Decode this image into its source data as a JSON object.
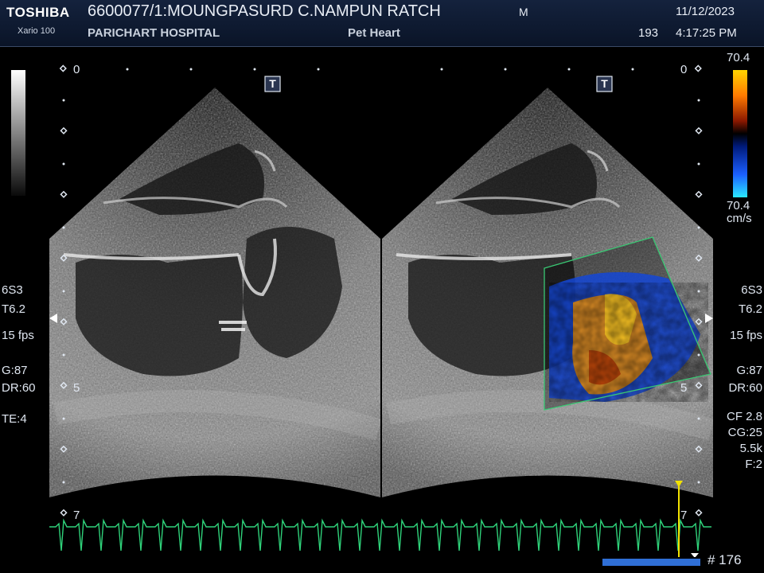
{
  "header": {
    "brand": "TOSHIBA",
    "model": "Xario 100",
    "patient": "6600077/1:MOUNGPASURD C.NAMPUN RATCH",
    "sex": "M",
    "hospital": "PARICHART HOSPITAL",
    "study": "Pet Heart",
    "date": "11/12/2023",
    "counter": "193",
    "time": "4:17:25 PM"
  },
  "scale": {
    "depth_top_left": "0",
    "depth_top_right": "0",
    "depth_mid_left": "5",
    "depth_mid_right": "5",
    "depth_bottom_left": "7",
    "depth_bottom_right": "7"
  },
  "colorbar": {
    "top": "70.4",
    "bottom": "70.4",
    "unit": "cm/s"
  },
  "left_params": [
    "6S3",
    "T6.2",
    "15 fps",
    "G:87",
    "DR:60",
    "TE:4"
  ],
  "right_params": [
    "6S3",
    "T6.2",
    "15 fps",
    "G:87",
    "DR:60",
    "CF 2.8",
    "CG:25",
    "5.5k",
    "F:2"
  ],
  "markers": {
    "left_t": "T",
    "right_t": "T"
  },
  "cine": {
    "frame": "# 176"
  },
  "colors": {
    "ecg": "#2fd27a",
    "cursor": "#f2e200",
    "cine_bar": "#2f6fd6",
    "header_bg": "#0a1427"
  }
}
